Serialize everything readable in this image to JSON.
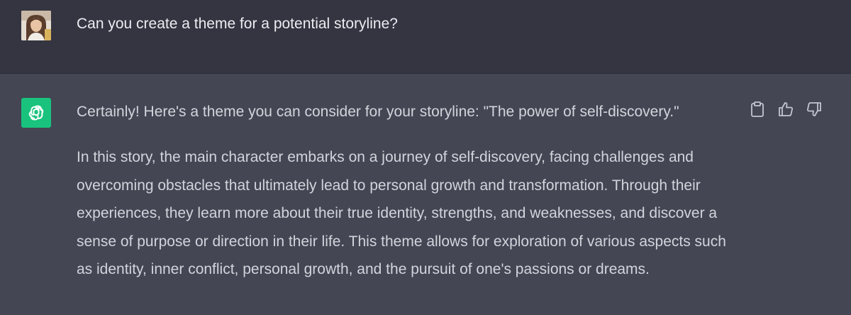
{
  "conversation": {
    "user_message": {
      "avatar_icon": "user-avatar",
      "text": "Can you create a theme for a potential storyline?"
    },
    "assistant_message": {
      "avatar_icon": "openai-logo-icon",
      "avatar_color": "#19c37d",
      "intro": "Certainly! Here's a theme you can consider for your storyline: \"The power of self-discovery.\"",
      "body": "In this story, the main character embarks on a journey of self-discovery, facing challenges and overcoming obstacles that ultimately lead to personal growth and transformation. Through their experiences, they learn more about their true identity, strengths, and weaknesses, and discover a sense of purpose or direction in their life. This theme allows for exploration of various aspects such as identity, inner conflict, personal growth, and the pursuit of one's passions or dreams."
    },
    "actions": [
      {
        "icon": "clipboard-icon"
      },
      {
        "icon": "thumbs-up-icon"
      },
      {
        "icon": "thumbs-down-icon"
      }
    ]
  },
  "colors": {
    "user_row_bg": "#343541",
    "assistant_row_bg": "#444654",
    "text": "#d1d5db"
  }
}
